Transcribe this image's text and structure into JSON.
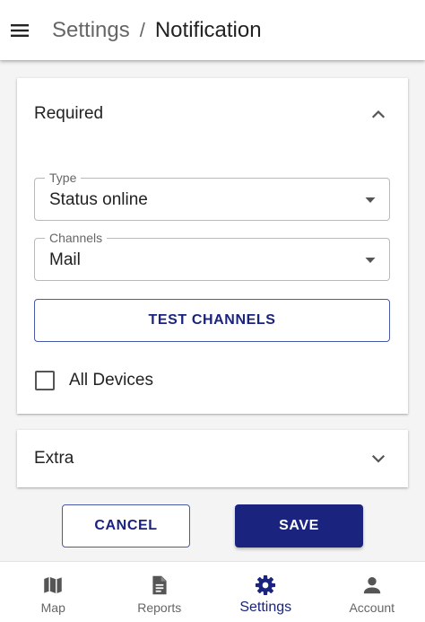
{
  "appbar": {
    "menu_icon": "menu-icon",
    "breadcrumb_parent": "Settings",
    "breadcrumb_separator": "/",
    "breadcrumb_current": "Notification"
  },
  "required": {
    "title": "Required",
    "expanded": true,
    "type_label": "Type",
    "type_value": "Status online",
    "channels_label": "Channels",
    "channels_value": "Mail",
    "test_button": "TEST CHANNELS",
    "all_devices_label": "All Devices",
    "all_devices_checked": false
  },
  "extra": {
    "title": "Extra",
    "expanded": false
  },
  "actions": {
    "cancel": "CANCEL",
    "save": "SAVE"
  },
  "bottom_nav": [
    {
      "label": "Map",
      "icon": "map-icon",
      "active": false
    },
    {
      "label": "Reports",
      "icon": "reports-icon",
      "active": false
    },
    {
      "label": "Settings",
      "icon": "settings-icon",
      "active": true
    },
    {
      "label": "Account",
      "icon": "account-icon",
      "active": false
    }
  ],
  "colors": {
    "primary": "#1a237e",
    "text": "#222222",
    "muted": "#666666",
    "background": "#f4f4f4"
  }
}
